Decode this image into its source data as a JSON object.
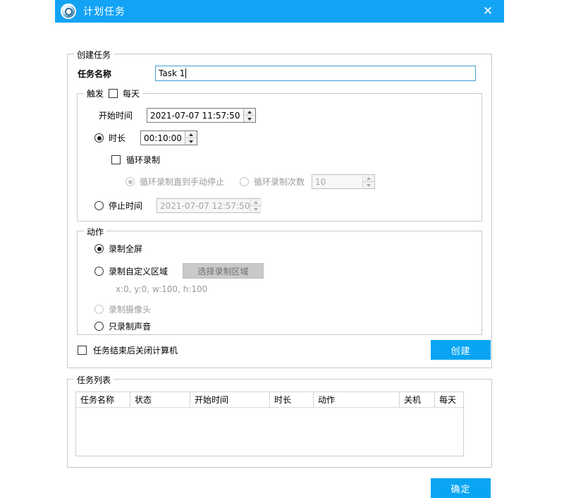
{
  "window": {
    "title": "计划任务",
    "icon": "app-disc-icon",
    "close_label": "✕",
    "accent_color": "#13A3F5",
    "button_color": "#09A5F2"
  },
  "create_group": {
    "legend": "创建任务",
    "task_name_label": "任务名称",
    "task_name_value": "Task 1"
  },
  "trigger_group": {
    "legend": "触发",
    "daily_label": "每天",
    "daily_checked": false,
    "start_time_label": "开始时间",
    "start_time_value": "2021-07-07 11:57:50",
    "duration_label": "时长",
    "duration_value": "00:10:00",
    "duration_selected": true,
    "loop_record_label": "循环录制",
    "loop_record_checked": false,
    "loop_until_stop_label": "循环录制直到手动停止",
    "loop_until_stop_selected": true,
    "loop_count_label": "循环录制次数",
    "loop_count_selected": false,
    "loop_count_value": "10",
    "stop_time_label": "停止时间",
    "stop_time_value": "2021-07-07 12:57:50",
    "stop_time_selected": false
  },
  "action_group": {
    "legend": "动作",
    "fullscreen_label": "录制全屏",
    "fullscreen_selected": true,
    "custom_region_label": "录制自定义区域",
    "custom_region_selected": false,
    "select_region_button": "选择录制区域",
    "region_info": "x:0, y:0, w:100, h:100",
    "webcam_label": "录制摄像头",
    "webcam_selected": false,
    "audio_only_label": "只录制声音",
    "audio_only_selected": false
  },
  "footer": {
    "shutdown_label": "任务结束后关闭计算机",
    "shutdown_checked": false,
    "create_button": "创建"
  },
  "task_list": {
    "legend": "任务列表",
    "columns": [
      "任务名称",
      "状态",
      "开始时间",
      "时长",
      "动作",
      "关机",
      "每天"
    ],
    "rows": []
  },
  "dialog": {
    "ok_button": "确定"
  }
}
